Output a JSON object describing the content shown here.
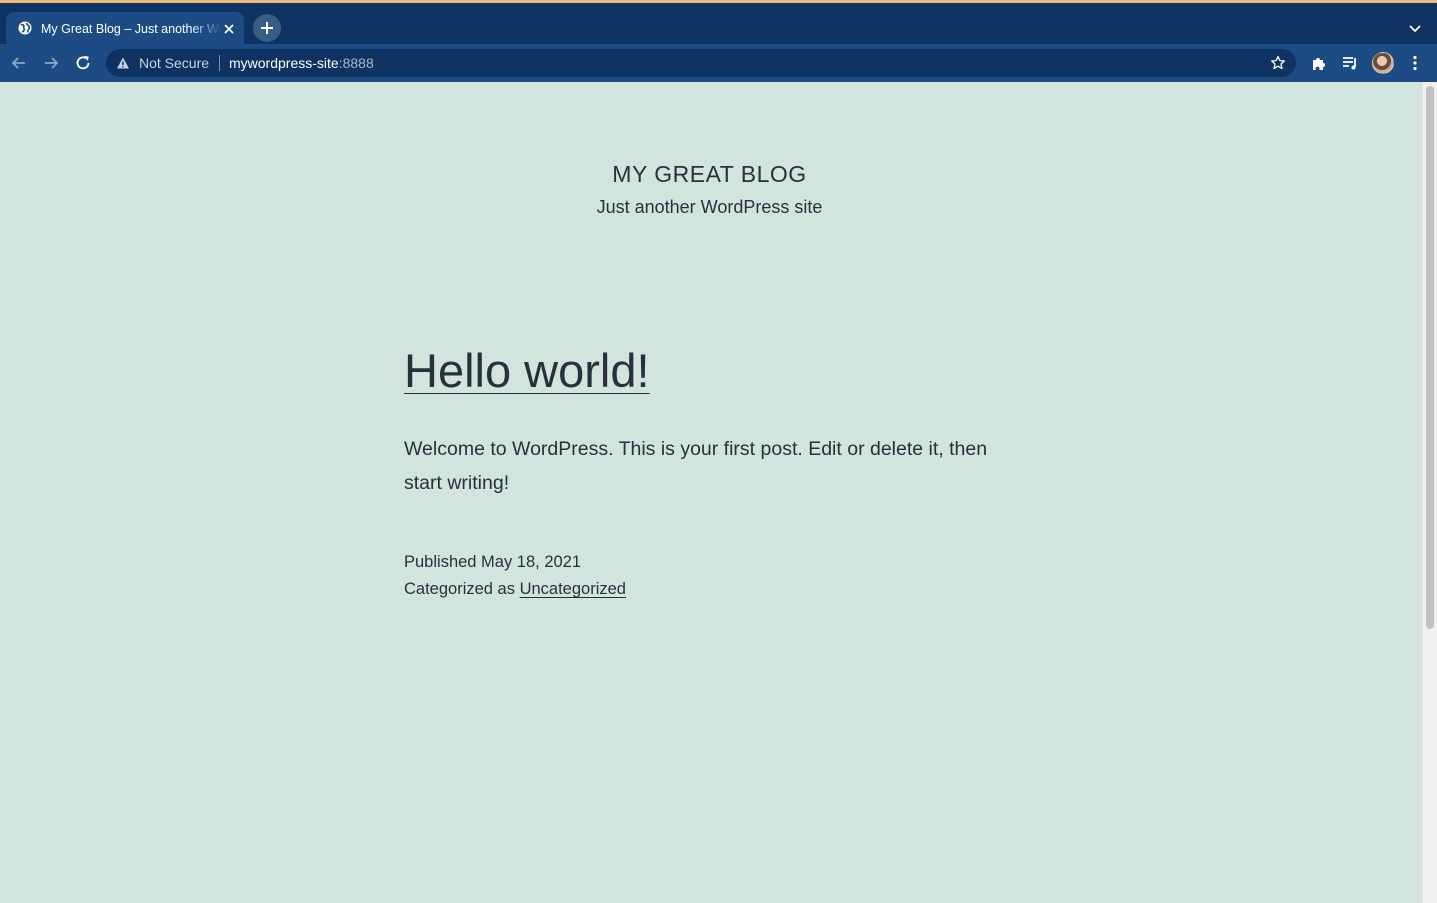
{
  "browser": {
    "tab_title": "My Great Blog – Just another WordPress site",
    "security_label": "Not Secure",
    "url_host": "mywordpress-site",
    "url_port": ":8888"
  },
  "site": {
    "title": "MY GREAT BLOG",
    "description": "Just another WordPress site"
  },
  "post": {
    "title": "Hello world!",
    "body": "Welcome to WordPress. This is your first post. Edit or delete it, then start writing!",
    "published_label": "Published May 18, 2021",
    "category_prefix": "Categorized as ",
    "category": "Uncategorized"
  },
  "colors": {
    "page_background": "#d1e4dd",
    "text": "#28303d",
    "browser_frame": "#0e3261",
    "browser_toolbar": "#1d4c84"
  }
}
